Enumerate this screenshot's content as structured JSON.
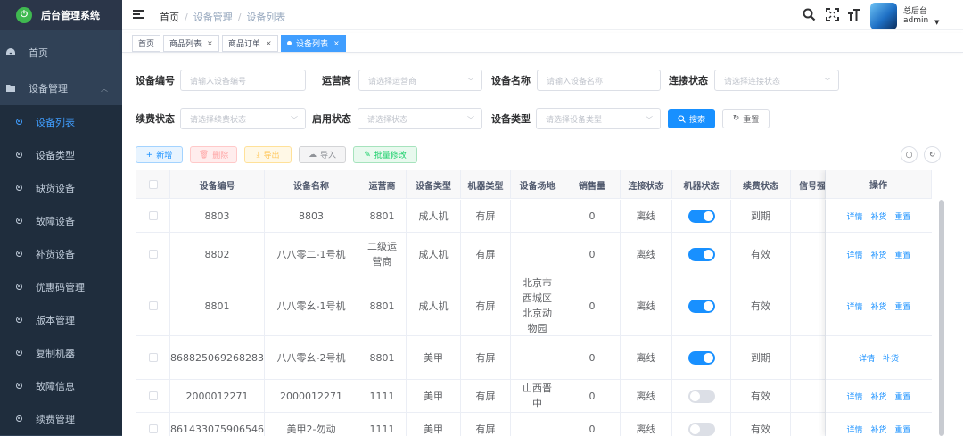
{
  "app": {
    "title": "后台管理系统",
    "logo_glyph": "⏻"
  },
  "sidebar": {
    "items": [
      {
        "label": "首页",
        "icon": "dashboard-icon"
      },
      {
        "label": "设备管理",
        "icon": "folder-icon",
        "expanded": true
      }
    ],
    "sub_items": [
      {
        "label": "设备列表",
        "active": true
      },
      {
        "label": "设备类型"
      },
      {
        "label": "缺货设备"
      },
      {
        "label": "故障设备"
      },
      {
        "label": "补货设备"
      },
      {
        "label": "优惠码管理"
      },
      {
        "label": "版本管理"
      },
      {
        "label": "复制机器"
      },
      {
        "label": "故障信息"
      },
      {
        "label": "续费管理"
      }
    ]
  },
  "navbar": {
    "breadcrumb": [
      "首页",
      "设备管理",
      "设备列表"
    ],
    "separator": "/",
    "user": {
      "name": "总后台",
      "role": "admin"
    }
  },
  "tags": [
    {
      "label": "首页",
      "closable": false
    },
    {
      "label": "商品列表",
      "closable": true
    },
    {
      "label": "商品订单",
      "closable": true
    },
    {
      "label": "设备列表",
      "closable": true,
      "active": true
    }
  ],
  "search": {
    "fields": [
      {
        "label": "设备编号",
        "placeholder": "请输入设备编号",
        "type": "input"
      },
      {
        "label": "运营商",
        "placeholder": "请选择运营商",
        "type": "select"
      },
      {
        "label": "设备名称",
        "placeholder": "请输入设备名称",
        "type": "input"
      },
      {
        "label": "连接状态",
        "placeholder": "请选择连接状态",
        "type": "select"
      },
      {
        "label": "续费状态",
        "placeholder": "请选择续费状态",
        "type": "select"
      },
      {
        "label": "启用状态",
        "placeholder": "请选择状态",
        "type": "select"
      },
      {
        "label": "设备类型",
        "placeholder": "请选择设备类型",
        "type": "select"
      }
    ],
    "search_button": "搜索",
    "reset_button": "重置"
  },
  "actions": {
    "add": "新增",
    "delete": "删除",
    "export": "导出",
    "import": "导入",
    "batch_edit": "批量修改"
  },
  "table": {
    "columns": [
      "设备编号",
      "设备名称",
      "运营商",
      "设备类型",
      "机器类型",
      "设备场地",
      "销售量",
      "连接状态",
      "机器状态",
      "续费状态",
      "信号强",
      "操作"
    ],
    "rows": [
      {
        "id": "8803",
        "name": "8803",
        "operator": "8801",
        "device_type": "成人机",
        "machine_type": "有屏",
        "site": "",
        "sales": "0",
        "connection": "离线",
        "machine_on": true,
        "renewal": "到期",
        "signal": "",
        "ops": [
          "详情",
          "补货",
          "重置"
        ]
      },
      {
        "id": "8802",
        "name": "八八零二-1号机",
        "operator": "二级运营商",
        "device_type": "成人机",
        "machine_type": "有屏",
        "site": "",
        "sales": "0",
        "connection": "离线",
        "machine_on": true,
        "renewal": "有效",
        "signal": "",
        "ops": [
          "详情",
          "补货",
          "重置"
        ]
      },
      {
        "id": "8801",
        "name": "八八零幺-1号机",
        "operator": "8801",
        "device_type": "成人机",
        "machine_type": "有屏",
        "site": "北京市西城区北京动物园",
        "sales": "0",
        "connection": "离线",
        "machine_on": true,
        "renewal": "有效",
        "signal": "",
        "ops": [
          "详情",
          "补货",
          "重置"
        ]
      },
      {
        "id": "868825069268283",
        "name": "八八零幺-2号机",
        "operator": "8801",
        "device_type": "美甲",
        "machine_type": "有屏",
        "site": "",
        "sales": "0",
        "connection": "离线",
        "machine_on": true,
        "renewal": "到期",
        "signal": "",
        "ops": [
          "详情",
          "补货"
        ]
      },
      {
        "id": "2000012271",
        "name": "2000012271",
        "operator": "1111",
        "device_type": "美甲",
        "machine_type": "有屏",
        "site": "山西晋中",
        "sales": "0",
        "connection": "离线",
        "machine_on": false,
        "renewal": "有效",
        "signal": "",
        "ops": [
          "详情",
          "补货",
          "重置"
        ]
      },
      {
        "id": "861433075906546",
        "name": "美甲2-勿动",
        "operator": "1111",
        "device_type": "美甲",
        "machine_type": "有屏",
        "site": "",
        "sales": "0",
        "connection": "离线",
        "machine_on": false,
        "renewal": "有效",
        "signal": "",
        "ops": [
          "详情",
          "补货",
          "重置"
        ]
      }
    ]
  },
  "colors": {
    "sidebar_bg": "#304156",
    "accent": "#1890ff",
    "active_menu": "#409eff"
  }
}
